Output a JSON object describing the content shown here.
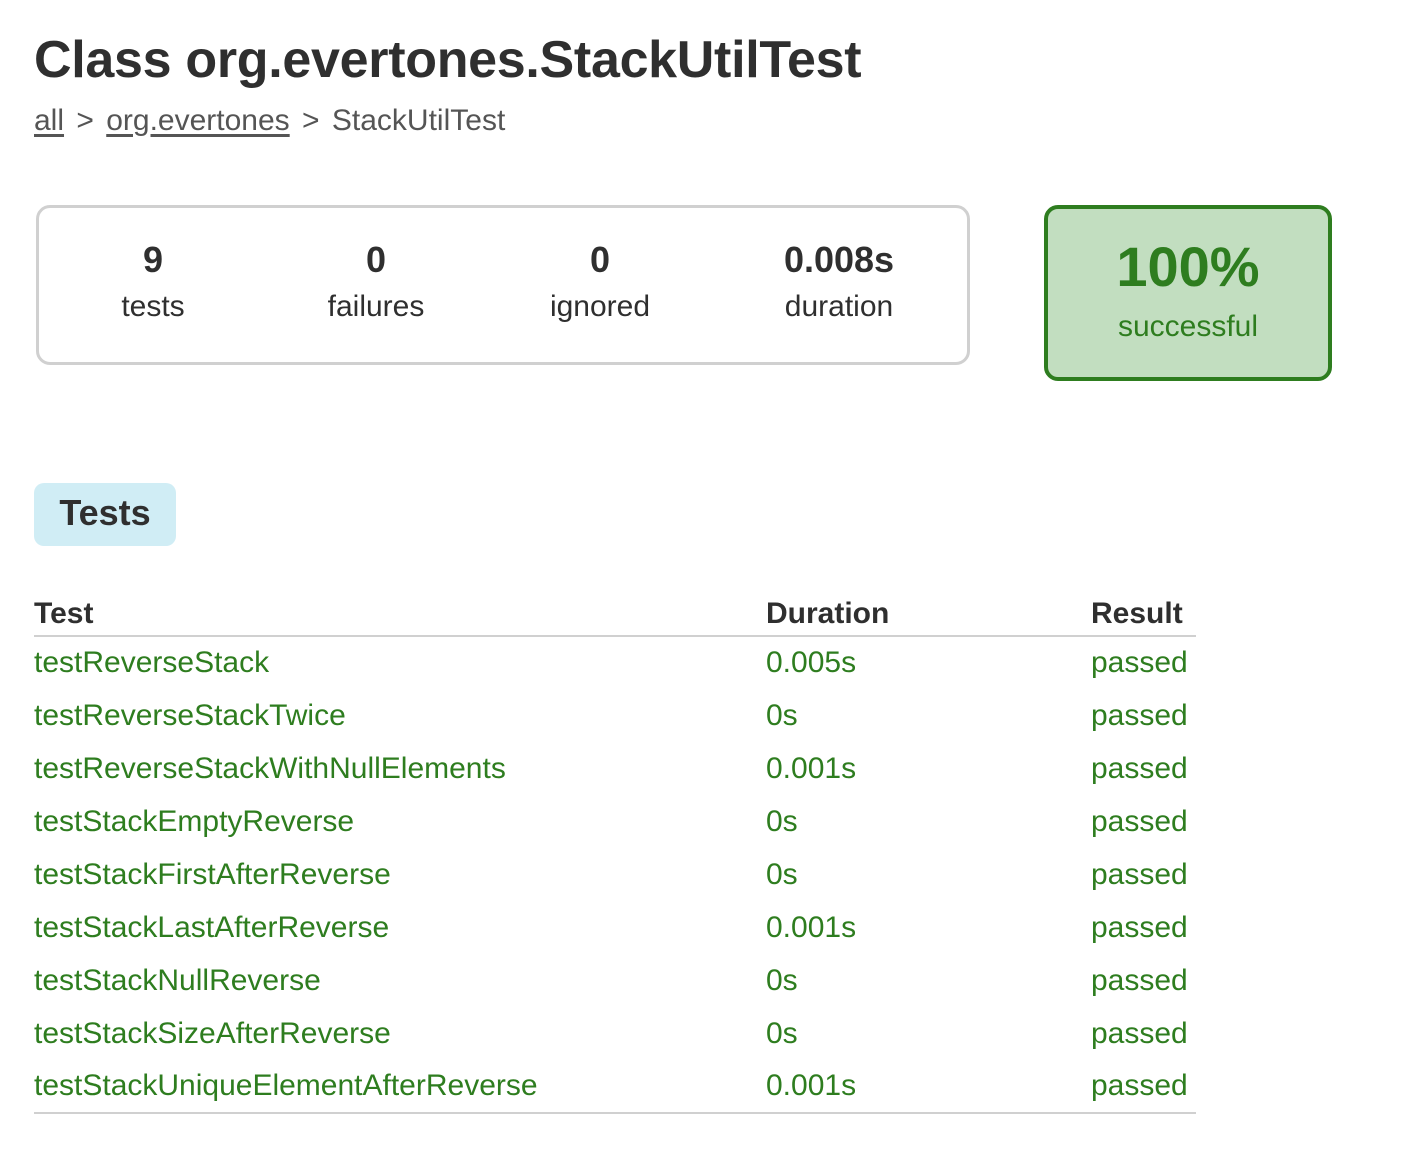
{
  "page": {
    "title": "Class org.evertones.StackUtilTest"
  },
  "breadcrumb": {
    "items": [
      {
        "label": "all",
        "link": true
      },
      {
        "label": "org.evertones",
        "link": true
      },
      {
        "label": "StackUtilTest",
        "link": false
      }
    ],
    "separator": ">"
  },
  "summary": {
    "tests": {
      "value": "9",
      "label": "tests"
    },
    "failures": {
      "value": "0",
      "label": "failures"
    },
    "ignored": {
      "value": "0",
      "label": "ignored"
    },
    "duration": {
      "value": "0.008s",
      "label": "duration"
    }
  },
  "success": {
    "percent": "100%",
    "label": "successful",
    "color": "#2e7d1f",
    "background": "#c2dec0"
  },
  "tabs": {
    "tests_label": "Tests"
  },
  "table": {
    "headers": {
      "test": "Test",
      "duration": "Duration",
      "result": "Result"
    },
    "rows": [
      {
        "test": "testReverseStack",
        "duration": "0.005s",
        "result": "passed"
      },
      {
        "test": "testReverseStackTwice",
        "duration": "0s",
        "result": "passed"
      },
      {
        "test": "testReverseStackWithNullElements",
        "duration": "0.001s",
        "result": "passed"
      },
      {
        "test": "testStackEmptyReverse",
        "duration": "0s",
        "result": "passed"
      },
      {
        "test": "testStackFirstAfterReverse",
        "duration": "0s",
        "result": "passed"
      },
      {
        "test": "testStackLastAfterReverse",
        "duration": "0.001s",
        "result": "passed"
      },
      {
        "test": "testStackNullReverse",
        "duration": "0s",
        "result": "passed"
      },
      {
        "test": "testStackSizeAfterReverse",
        "duration": "0s",
        "result": "passed"
      },
      {
        "test": "testStackUniqueElementAfterReverse",
        "duration": "0.001s",
        "result": "passed"
      }
    ],
    "row_color": "#2e7d1f"
  }
}
